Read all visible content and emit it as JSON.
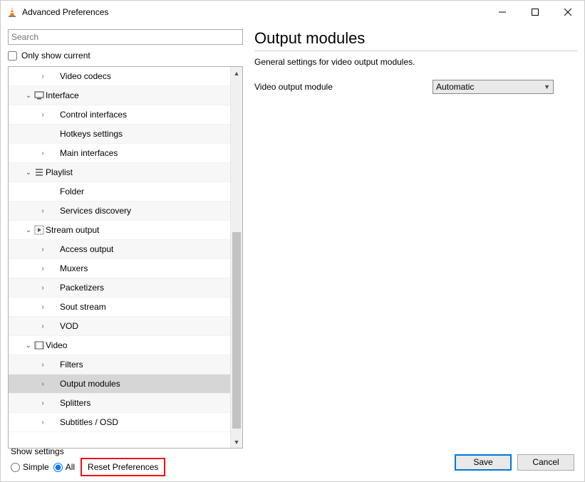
{
  "window": {
    "title": "Advanced Preferences"
  },
  "search": {
    "placeholder": "Search"
  },
  "only_show_current": "Only show current",
  "tree": {
    "items": [
      {
        "level": 2,
        "exp": ">",
        "icon": "",
        "label": "Video codecs"
      },
      {
        "level": 1,
        "exp": "v",
        "icon": "interface",
        "label": "Interface"
      },
      {
        "level": 2,
        "exp": ">",
        "icon": "",
        "label": "Control interfaces"
      },
      {
        "level": 2,
        "exp": "",
        "icon": "",
        "label": "Hotkeys settings"
      },
      {
        "level": 2,
        "exp": ">",
        "icon": "",
        "label": "Main interfaces"
      },
      {
        "level": 1,
        "exp": "v",
        "icon": "playlist",
        "label": "Playlist"
      },
      {
        "level": 2,
        "exp": "",
        "icon": "",
        "label": "Folder"
      },
      {
        "level": 2,
        "exp": ">",
        "icon": "",
        "label": "Services discovery"
      },
      {
        "level": 1,
        "exp": "v",
        "icon": "stream",
        "label": "Stream output"
      },
      {
        "level": 2,
        "exp": ">",
        "icon": "",
        "label": "Access output"
      },
      {
        "level": 2,
        "exp": ">",
        "icon": "",
        "label": "Muxers"
      },
      {
        "level": 2,
        "exp": ">",
        "icon": "",
        "label": "Packetizers"
      },
      {
        "level": 2,
        "exp": ">",
        "icon": "",
        "label": "Sout stream"
      },
      {
        "level": 2,
        "exp": ">",
        "icon": "",
        "label": "VOD"
      },
      {
        "level": 1,
        "exp": "v",
        "icon": "video",
        "label": "Video"
      },
      {
        "level": 2,
        "exp": ">",
        "icon": "",
        "label": "Filters"
      },
      {
        "level": 2,
        "exp": ">",
        "icon": "",
        "label": "Output modules",
        "selected": true
      },
      {
        "level": 2,
        "exp": ">",
        "icon": "",
        "label": "Splitters"
      },
      {
        "level": 2,
        "exp": ">",
        "icon": "",
        "label": "Subtitles / OSD"
      }
    ]
  },
  "panel": {
    "title": "Output modules",
    "subtitle": "General settings for video output modules.",
    "setting_label": "Video output module",
    "setting_value": "Automatic"
  },
  "footer": {
    "show_settings": "Show settings",
    "simple": "Simple",
    "all": "All",
    "reset": "Reset Preferences",
    "save": "Save",
    "cancel": "Cancel"
  }
}
